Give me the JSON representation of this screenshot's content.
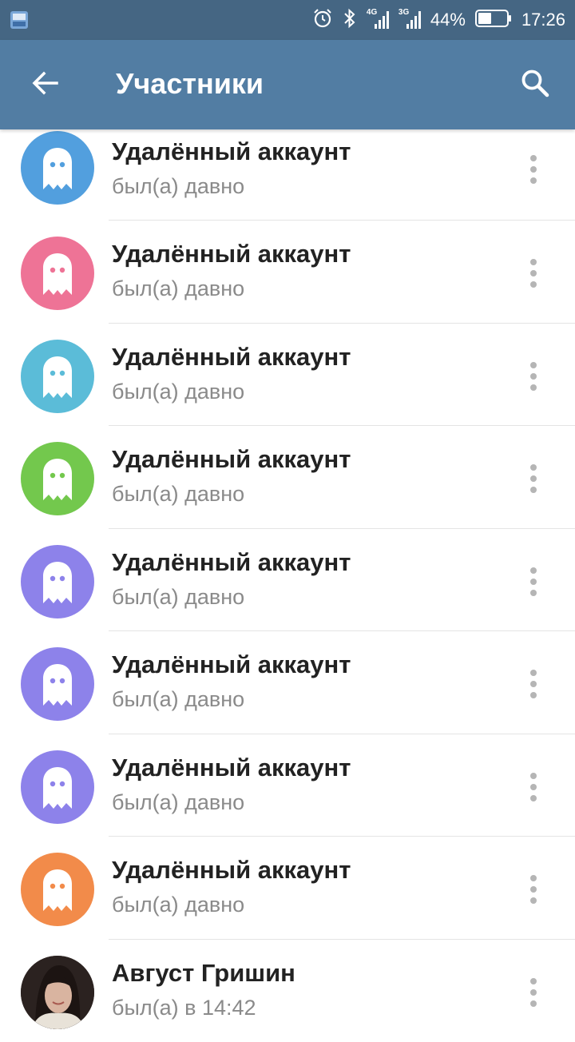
{
  "status_bar": {
    "battery": "44%",
    "time": "17:26",
    "net1": "4G",
    "net2": "3G"
  },
  "app_bar": {
    "title": "Участники",
    "back_icon": "arrow-back-icon",
    "search_icon": "search-icon"
  },
  "members": [
    {
      "name": "Удалённый аккаунт",
      "status": "был(а) давно",
      "avatar": "ghost",
      "color": "#529fde"
    },
    {
      "name": "Удалённый аккаунт",
      "status": "был(а) давно",
      "avatar": "ghost",
      "color": "#ee7396"
    },
    {
      "name": "Удалённый аккаунт",
      "status": "был(а) давно",
      "avatar": "ghost",
      "color": "#5bbcd8"
    },
    {
      "name": "Удалённый аккаунт",
      "status": "был(а) давно",
      "avatar": "ghost",
      "color": "#73c84d"
    },
    {
      "name": "Удалённый аккаунт",
      "status": "был(а) давно",
      "avatar": "ghost",
      "color": "#8d82ea"
    },
    {
      "name": "Удалённый аккаунт",
      "status": "был(а) давно",
      "avatar": "ghost",
      "color": "#8d82ea"
    },
    {
      "name": "Удалённый аккаунт",
      "status": "был(а) давно",
      "avatar": "ghost",
      "color": "#8d82ea"
    },
    {
      "name": "Удалённый аккаунт",
      "status": "был(а) давно",
      "avatar": "ghost",
      "color": "#f28b4a"
    },
    {
      "name": "Август Гришин",
      "status": "был(а) в 14:42",
      "avatar": "photo",
      "color": "#3a2e2a"
    }
  ]
}
